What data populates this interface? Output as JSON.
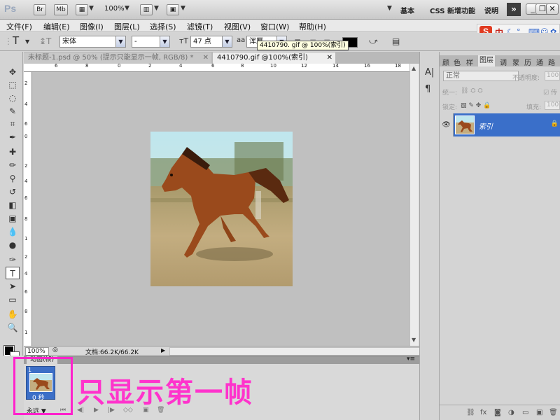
{
  "app": {
    "logo": "Ps",
    "bridge": "Br",
    "minibridge": "Mb",
    "zoom": "100%",
    "workspaces": [
      "基本",
      "CSS 新增功能",
      "说明"
    ],
    "more": "»"
  },
  "menu": [
    "文件(F)",
    "编辑(E)",
    "图像(I)",
    "图层(L)",
    "选择(S)",
    "滤镜(T)",
    "视图(V)",
    "窗口(W)",
    "帮助(H)"
  ],
  "ime": {
    "logo": "S",
    "lang": "中"
  },
  "options": {
    "font_family": "宋体",
    "font_style": "-",
    "font_size": "47 点",
    "aa_label": "aa",
    "aa_mode": "浑厚",
    "tooltip": "4410790. gif @ 100%(索引)"
  },
  "tabs": [
    {
      "label": "未标题-1.psd @ 50% (提示只能显示一帧, RGB/8) *"
    },
    {
      "label": "4410790.gif @100%(索引)"
    }
  ],
  "ruler_h": [
    "6",
    "8",
    "0",
    "2",
    "4",
    "6",
    "8",
    "10",
    "12",
    "14",
    "16",
    "18"
  ],
  "ruler_v": [
    "2",
    "4",
    "6",
    "0",
    "2",
    "4",
    "6",
    "8",
    "1",
    "2",
    "4",
    "6",
    "8",
    "1"
  ],
  "status": {
    "zoom": "100%",
    "doc": "文档:66.2K/66.2K"
  },
  "animation": {
    "panel_title": "动画(帧)",
    "frame_number": "1",
    "frame_delay": "0 秒",
    "loop": "永远"
  },
  "annotation": "只显示第一帧",
  "layers": {
    "tabs": [
      "颜",
      "色",
      "样",
      "图层",
      "调",
      "蒙",
      "历",
      "通",
      "路"
    ],
    "blend_mode": "正常",
    "opacity_label": "不透明度:",
    "opacity": "100",
    "unify_label": "统一:",
    "propagate_label": "传",
    "lock_label": "锁定:",
    "fill_label": "填充:",
    "fill": "100",
    "layer_name": "索引"
  },
  "colors": {
    "accent": "#3a6fc9",
    "annotation": "#ff33cc"
  }
}
